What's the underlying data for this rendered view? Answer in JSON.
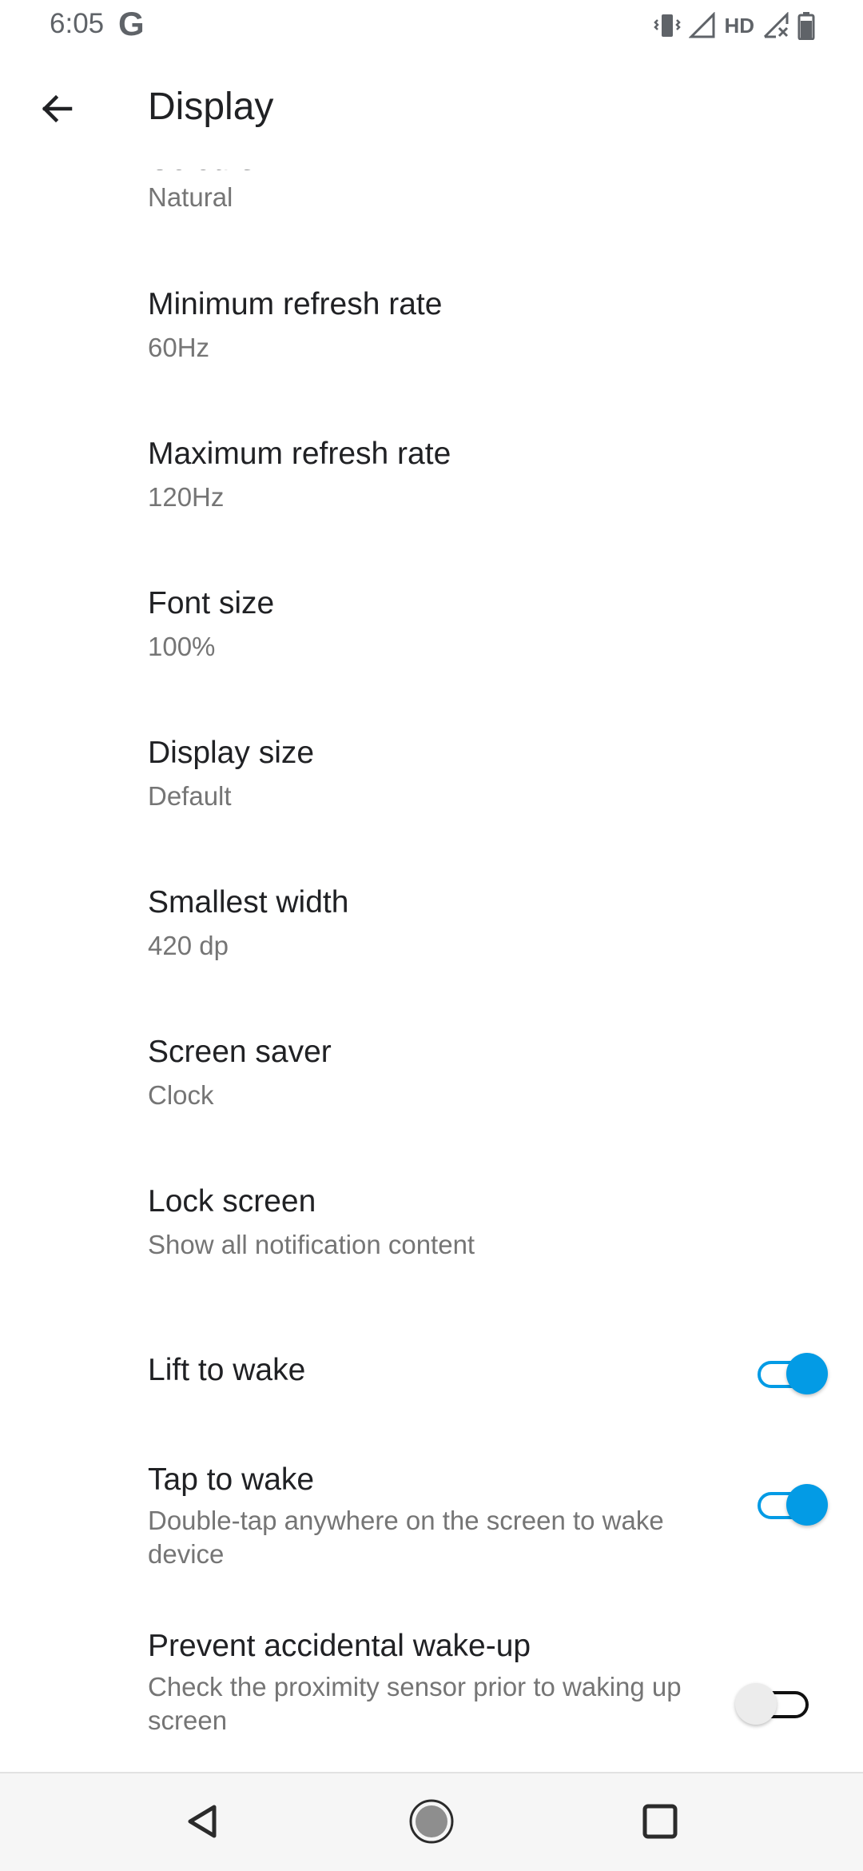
{
  "status_bar": {
    "time": "6:05",
    "app_icon_letter": "G",
    "network_label": "HD"
  },
  "header": {
    "title": "Display"
  },
  "settings": [
    {
      "title": "Colours",
      "summary": "Natural"
    },
    {
      "title": "Minimum refresh rate",
      "summary": "60Hz"
    },
    {
      "title": "Maximum refresh rate",
      "summary": "120Hz"
    },
    {
      "title": "Font size",
      "summary": "100%"
    },
    {
      "title": "Display size",
      "summary": "Default"
    },
    {
      "title": "Smallest width",
      "summary": "420 dp"
    },
    {
      "title": "Screen saver",
      "summary": "Clock"
    },
    {
      "title": "Lock screen",
      "summary": "Show all notification content"
    },
    {
      "title": "Lift to wake",
      "summary": "",
      "toggle": true
    },
    {
      "title": "Tap to wake",
      "summary": "Double-tap anywhere on the screen to wake device",
      "toggle": true
    },
    {
      "title": "Prevent accidental wake-up",
      "summary": "Check the proximity sensor prior to waking up screen",
      "toggle": false
    }
  ],
  "colors": {
    "accent": "#039be5",
    "title_text": "#202124",
    "summary_text": "#757575"
  },
  "icons": {
    "back": "arrow-left-icon",
    "vibrate": "vibrate-icon",
    "signal": "signal-icon",
    "signal_no_sim": "signal-x-icon",
    "battery": "battery-icon",
    "nav_back": "triangle-back-icon",
    "nav_home": "circle-home-icon",
    "nav_recents": "square-recents-icon"
  }
}
